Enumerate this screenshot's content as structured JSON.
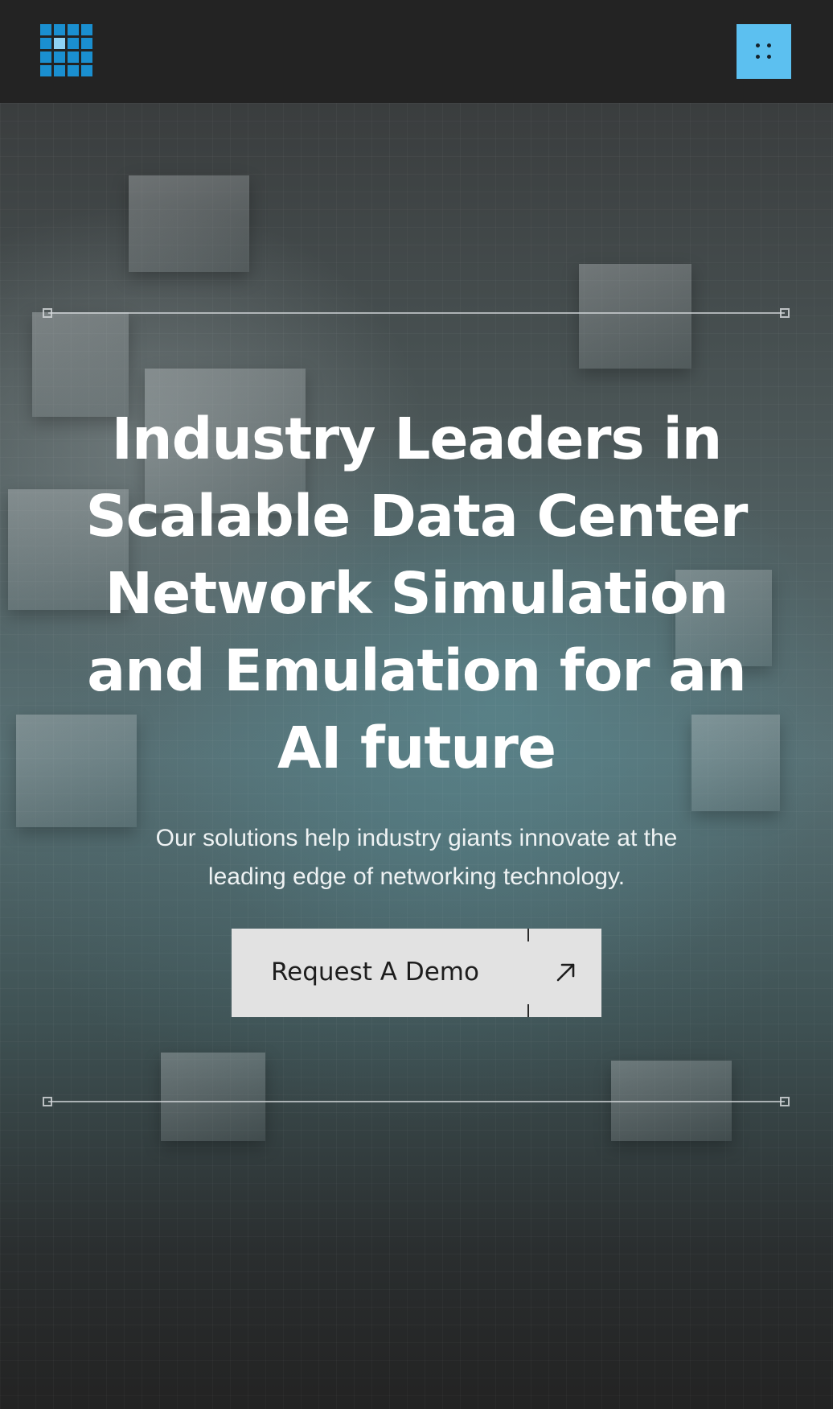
{
  "header": {
    "logo_icon": "grid-logo-icon",
    "menu_icon": "menu-dots-icon",
    "menu_color": "#5cc0f0",
    "logo_color": "#1a8fd0"
  },
  "hero": {
    "headline": "Industry Leaders in Scalable Data Center Network Simulation and Emulation for an AI future",
    "subline": "Our solutions help industry giants innovate at the leading edge of networking technology.",
    "cta_label": "Request A Demo",
    "cta_icon": "arrow-up-right-icon"
  }
}
